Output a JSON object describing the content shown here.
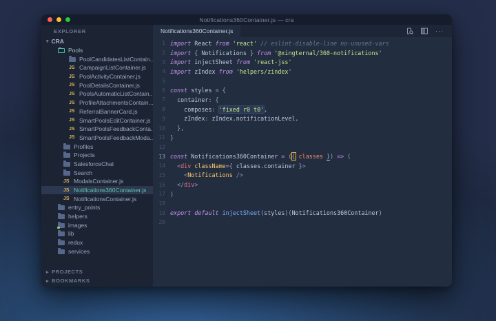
{
  "window": {
    "title": "Notifications360Container.js — cra"
  },
  "titlebar_buttons": [
    "close",
    "minimize",
    "zoom"
  ],
  "sidebar": {
    "header": "EXPLORER",
    "root_label": "CRA",
    "root_chevron": "▾",
    "section_chevron": "▸",
    "js_badge": "JS",
    "tree": [
      {
        "label": "Pools",
        "icon": "folder-open",
        "depth": 1,
        "tint": "teal"
      },
      {
        "label": "PoolCandidatesListContain...",
        "icon": "folder",
        "depth": 3
      },
      {
        "label": "CampaignListContainer.js",
        "icon": "js",
        "depth": 3
      },
      {
        "label": "PoolActivityContainer.js",
        "icon": "js",
        "depth": 3
      },
      {
        "label": "PoolDetailsContainer.js",
        "icon": "js",
        "depth": 3
      },
      {
        "label": "PoolsAutomaticListContain...",
        "icon": "js",
        "depth": 3
      },
      {
        "label": "ProfileAttachmentsContain...",
        "icon": "js",
        "depth": 3
      },
      {
        "label": "ReferralBannerCard.js",
        "icon": "js",
        "depth": 3
      },
      {
        "label": "SmartPoolsEditContainer.js",
        "icon": "js",
        "depth": 3
      },
      {
        "label": "SmartPoolsFeedbackConta...",
        "icon": "js",
        "depth": 3
      },
      {
        "label": "SmartPoolsFeedbackModa...",
        "icon": "js",
        "depth": 3
      },
      {
        "label": "Profiles",
        "icon": "folder",
        "depth": 2
      },
      {
        "label": "Projects",
        "icon": "folder",
        "depth": 2
      },
      {
        "label": "SalesforceChat",
        "icon": "folder",
        "depth": 2
      },
      {
        "label": "Search",
        "icon": "folder",
        "depth": 2
      },
      {
        "label": "ModalsContainer.js",
        "icon": "js",
        "depth": 2
      },
      {
        "label": "Notifications360Container.js",
        "icon": "js",
        "depth": 2,
        "selected": true
      },
      {
        "label": "NotificationsContainer.js",
        "icon": "js",
        "depth": 2
      },
      {
        "label": "entry_points",
        "icon": "folder",
        "depth": 1
      },
      {
        "label": "helpers",
        "icon": "folder",
        "depth": 1
      },
      {
        "label": "images",
        "icon": "folder-badge",
        "depth": 1
      },
      {
        "label": "lib",
        "icon": "folder",
        "depth": 1
      },
      {
        "label": "redux",
        "icon": "folder",
        "depth": 1
      },
      {
        "label": "services",
        "icon": "folder",
        "depth": 1
      }
    ],
    "sections": [
      "PROJECTS",
      "BOOKMARKS"
    ]
  },
  "editor": {
    "tab": {
      "label": "Notifications360Container.js"
    },
    "actions": [
      "open-preview-icon",
      "split-editor-icon",
      "more-actions-icon"
    ],
    "more_glyph": "···",
    "active_line": 13,
    "lines": [
      {
        "num": 1,
        "tokens": [
          [
            "kw",
            "import "
          ],
          [
            "id",
            "React "
          ],
          [
            "kw",
            "from "
          ],
          [
            "str",
            "'react' "
          ],
          [
            "cm",
            "// eslint-disable-line no-unused-vars"
          ]
        ]
      },
      {
        "num": 2,
        "tokens": [
          [
            "kw",
            "import "
          ],
          [
            "pn",
            "{ "
          ],
          [
            "id",
            "Notifications "
          ],
          [
            "pn",
            "} "
          ],
          [
            "kw",
            "from "
          ],
          [
            "str",
            "'@xingternal/360-notifications'"
          ]
        ]
      },
      {
        "num": 3,
        "tokens": [
          [
            "kw",
            "import "
          ],
          [
            "id",
            "injectSheet "
          ],
          [
            "kw",
            "from "
          ],
          [
            "str",
            "'react-jss'"
          ]
        ]
      },
      {
        "num": 4,
        "tokens": [
          [
            "kw",
            "import "
          ],
          [
            "id",
            "zIndex "
          ],
          [
            "kw",
            "from "
          ],
          [
            "str",
            "'helpers/zindex'"
          ]
        ]
      },
      {
        "num": 5,
        "tokens": []
      },
      {
        "num": 6,
        "tokens": [
          [
            "kw",
            "const "
          ],
          [
            "id",
            "styles "
          ],
          [
            "op",
            "= "
          ],
          [
            "pn",
            "{"
          ]
        ]
      },
      {
        "num": 7,
        "tokens": [
          [
            "id",
            "  container"
          ],
          [
            "pn",
            ": {"
          ]
        ]
      },
      {
        "num": 8,
        "tokens": [
          [
            "id",
            "    composes"
          ],
          [
            "pn",
            ": "
          ],
          [
            "strhl",
            "'fixed r0 t0'"
          ],
          [
            "pn",
            ","
          ]
        ]
      },
      {
        "num": 9,
        "tokens": [
          [
            "id",
            "    zIndex"
          ],
          [
            "pn",
            ": "
          ],
          [
            "id",
            "zIndex.notificationLevel"
          ],
          [
            "pn",
            ","
          ]
        ]
      },
      {
        "num": 10,
        "tokens": [
          [
            "pn",
            "  },"
          ]
        ]
      },
      {
        "num": 11,
        "tokens": [
          [
            "pn",
            "}"
          ]
        ]
      },
      {
        "num": 12,
        "tokens": []
      },
      {
        "num": 13,
        "tokens": [
          [
            "kw",
            "const "
          ],
          [
            "id",
            "Notifications360Container "
          ],
          [
            "op",
            "= "
          ],
          [
            "pn",
            "("
          ],
          [
            "cursor",
            "{"
          ],
          [
            "param",
            " classes "
          ],
          [
            "uline",
            "}"
          ],
          [
            "pn",
            ") "
          ],
          [
            "op",
            "=> "
          ],
          [
            "pn",
            "("
          ]
        ]
      },
      {
        "num": 14,
        "tokens": [
          [
            "tagp",
            "  <"
          ],
          [
            "tag",
            "div "
          ],
          [
            "attr",
            "className"
          ],
          [
            "op",
            "="
          ],
          [
            "pn",
            "{ "
          ],
          [
            "id",
            "classes.container "
          ],
          [
            "pn",
            "}"
          ],
          [
            "tagp",
            ">"
          ]
        ]
      },
      {
        "num": 15,
        "tokens": [
          [
            "tagp",
            "    <"
          ],
          [
            "cmp",
            "Notifications "
          ],
          [
            "tagp",
            "/>"
          ]
        ]
      },
      {
        "num": 16,
        "tokens": [
          [
            "tagp",
            "  </"
          ],
          [
            "tag",
            "div"
          ],
          [
            "tagp",
            ">"
          ]
        ]
      },
      {
        "num": 17,
        "tokens": [
          [
            "pn",
            ")"
          ]
        ]
      },
      {
        "num": 18,
        "tokens": []
      },
      {
        "num": 19,
        "tokens": [
          [
            "kw",
            "export "
          ],
          [
            "kw",
            "default "
          ],
          [
            "fn",
            "injectSheet"
          ],
          [
            "pn",
            "("
          ],
          [
            "id",
            "styles"
          ],
          [
            "pn",
            ")("
          ],
          [
            "id",
            "Notifications360Container"
          ],
          [
            "pn",
            ")"
          ]
        ]
      },
      {
        "num": 20,
        "tokens": []
      }
    ]
  },
  "colors": {
    "kw": "#c792ea",
    "str": "#c3e88d",
    "cm": "#697498",
    "id": "#bfc7e0",
    "pn": "#9aa3c2",
    "op": "#c792ea",
    "tag": "#f07178",
    "tagp": "#8f99b8",
    "attr": "#ffcb6b",
    "cmp": "#ffcb6b",
    "fn": "#82aaff",
    "param": "#f78c6c",
    "accent-teal": "#63c1a8",
    "js-badge": "#d9b35f",
    "cursor": "#ffb62c",
    "editor-bg": "#232d40",
    "sidebar-bg": "#1c2434",
    "titlebar-bg": "#151c2b",
    "selected-row": "#2c3850",
    "light-red": "#ff5f57",
    "light-yellow": "#febc2e",
    "light-green": "#28c840"
  }
}
